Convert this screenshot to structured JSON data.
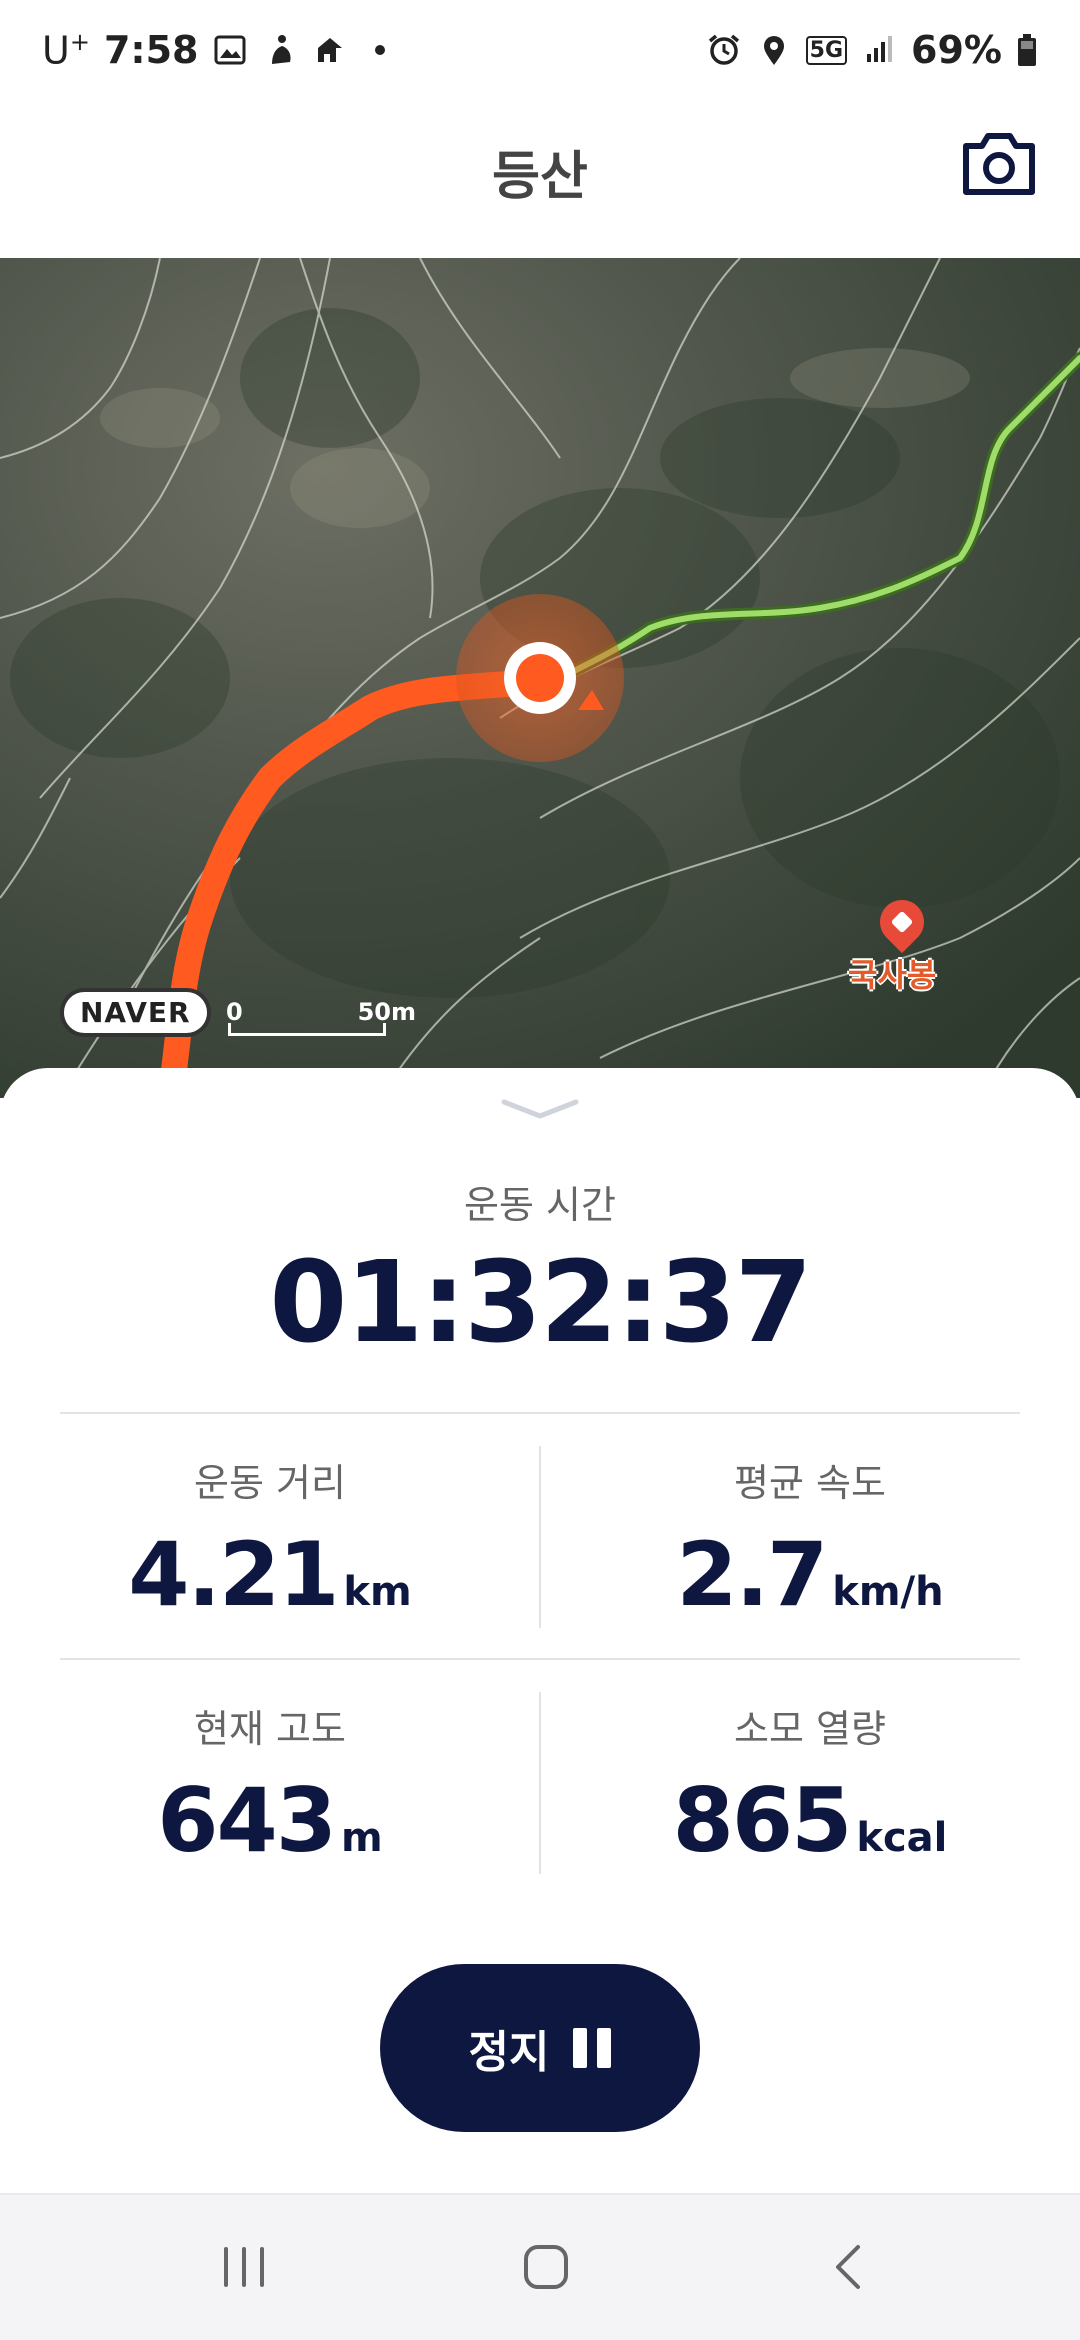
{
  "status_bar": {
    "carrier": "U",
    "carrier_sup": "+",
    "time": "7:58",
    "network": "5G",
    "battery": "69%",
    "left_icons": [
      "gallery-icon",
      "fitness-icon",
      "navigation-icon",
      "dot-icon"
    ],
    "right_icons": [
      "alarm-icon",
      "location-icon",
      "5g-icon",
      "signal-icon",
      "battery-icon"
    ]
  },
  "header": {
    "title": "등산",
    "camera_icon": "camera-icon"
  },
  "map": {
    "provider_badge": "NAVER",
    "scale_start": "0",
    "scale_end": "50m",
    "poi_name": "국사봉",
    "route_color": "#ff5a1f",
    "trail_color": "#8fd05a"
  },
  "workout": {
    "time_label": "운동 시간",
    "time_value": "01:32:37",
    "stats": [
      {
        "label": "운동 거리",
        "value": "4.21",
        "unit": "km"
      },
      {
        "label": "평균 속도",
        "value": "2.7",
        "unit": "km/h"
      },
      {
        "label": "현재 고도",
        "value": "643",
        "unit": "m"
      },
      {
        "label": "소모 열량",
        "value": "865",
        "unit": "kcal"
      }
    ],
    "stop_label": "정지"
  },
  "colors": {
    "accent_navy": "#0e1740",
    "label_gray": "#666666"
  },
  "nav_bar": {
    "icons": [
      "recents-icon",
      "home-icon",
      "back-icon"
    ]
  }
}
